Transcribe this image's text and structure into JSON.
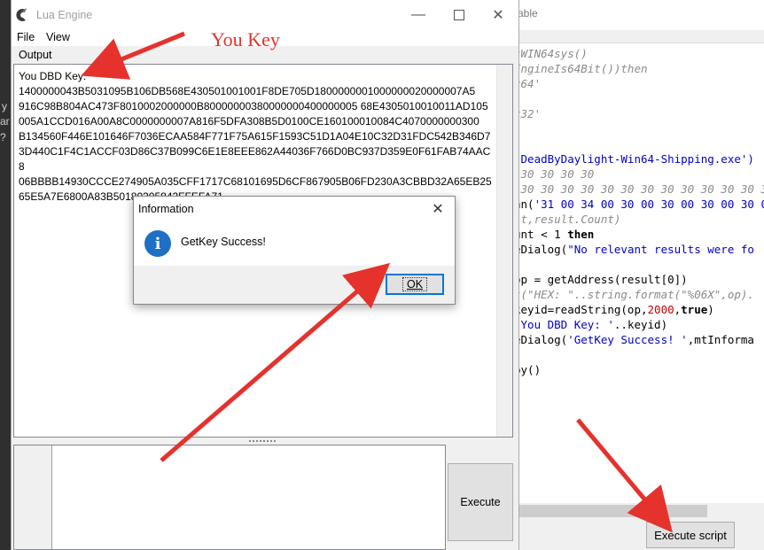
{
  "background_editor": {
    "title_fragment": "able",
    "code_lines": [
      {
        "parts": [
          {
            "t": "sWIN64sys()",
            "c": "c-gray"
          }
        ]
      },
      {
        "parts": [
          {
            "t": "EngineIs64Bit())then",
            "c": "c-gray"
          }
        ]
      },
      {
        "parts": [
          {
            "t": "x64'",
            "c": "c-gray"
          }
        ]
      },
      {
        "parts": []
      },
      {
        "parts": [
          {
            "t": "x32'",
            "c": "c-gray"
          }
        ]
      },
      {
        "parts": []
      },
      {
        "parts": []
      },
      {
        "parts": [
          {
            "t": "'DeadByDaylight-Win64-Shipping.exe')",
            "c": "c-blue"
          }
        ]
      },
      {
        "parts": [
          {
            "t": " 30 30 30 30",
            "c": "c-gray"
          }
        ]
      },
      {
        "parts": [
          {
            "t": " 30 30 30 30 30 30 30 30 30 30 30 30 30 30 (",
            "c": "c-gray"
          }
        ]
      },
      {
        "parts": [
          {
            "t": "an(",
            "c": "c-black"
          },
          {
            "t": "'31 00 34 00 30 00 30 00 30 00 30 00 30 00",
            "c": "c-blue"
          }
        ]
      },
      {
        "parts": [
          {
            "t": "lt,result.Count)",
            "c": "c-gray"
          }
        ]
      },
      {
        "parts": [
          {
            "t": "unt < ",
            "c": "c-black"
          },
          {
            "t": "1",
            "c": "c-black"
          },
          {
            "t": " then",
            "c": "c-black c-bold"
          }
        ]
      },
      {
        "parts": [
          {
            "t": "eDialog(",
            "c": "c-black"
          },
          {
            "t": "\"No relevant results were fo",
            "c": "c-blue"
          }
        ]
      },
      {
        "parts": []
      },
      {
        "parts": [
          {
            "t": "op = getAddress(result[",
            "c": "c-black"
          },
          {
            "t": "0",
            "c": "c-black"
          },
          {
            "t": "])",
            "c": "c-black"
          }
        ]
      },
      {
        "parts": [
          {
            "t": "t(\"HEX: \"..string.format(\"%06X\",op).",
            "c": "c-gray"
          }
        ]
      },
      {
        "parts": [
          {
            "t": "keyid=readString(op,",
            "c": "c-black"
          },
          {
            "t": "2000",
            "c": "c-red"
          },
          {
            "t": ",",
            "c": "c-black"
          },
          {
            "t": "true",
            "c": "c-black c-bold"
          },
          {
            "t": ")",
            "c": "c-black"
          }
        ]
      },
      {
        "parts": [
          {
            "t": "'You DBD Key: '",
            "c": "c-blue"
          },
          {
            "t": "..keyid)",
            "c": "c-black"
          }
        ]
      },
      {
        "parts": [
          {
            "t": "eDialog(",
            "c": "c-black"
          },
          {
            "t": "'GetKey Success! '",
            "c": "c-blue"
          },
          {
            "t": ",mtInforma",
            "c": "c-black"
          }
        ]
      },
      {
        "parts": []
      },
      {
        "parts": [
          {
            "t": "py()",
            "c": "c-black"
          }
        ]
      }
    ],
    "execute_script_label": "Execute script"
  },
  "left_sliver": {
    "fragments": [
      "y",
      "ar",
      "?"
    ]
  },
  "lua_window": {
    "title": "Lua Engine",
    "menu": {
      "file": "File",
      "view": "View"
    },
    "output_label": "Output",
    "output_text": "You DBD Key: 1400000043B5031095B106DB568E430501001001F8DE705D180000000100000002000000 7A5916C98B804AC473F8010002000000B80000000380000000400000005 68E4305010010011AD105005A1CCD016A00A8C0000000007A816F5DFA30 8B5D0100CE16010001 0084C4070000000300B134560F446E101646F703 6ECAA584F771F75A615F1593C51D1A04E10C32D31FDC542B346D73D440C 1F4C1ACCF03D86C37B099C6E1E8EEE862A44036F766D0BC937D359E0F61 FAB74AAC806BBBB14930CCCE274905A035CFF1717C68101695D6CF867905 B06FD230A3CBBD32A65EB2565E5A7E6800A83B50180305843FFEFA71",
    "output_heading": "You DBD Key:",
    "output_key_lines": [
      "1400000043B5031095B106DB568E430501001001F8DE705D1800000001000000020000007A5",
      "916C98B804AC473F8010002000000B80000000380000000400000005 68E4305010010011AD105",
      "005A1CCD016A00A8C0000000007A816F5DFA308B5D0100CE160100010084C4070000000300",
      "B134560F446E101646F7036ECAA584F771F75A615F1593C51D1A04E10C32D31FDC542B346D7",
      "3D440C1F4C1ACCF03D86C37B099C6E1E8EEE862A44036F766D0BC937D359E0F61FAB74AAC8",
      "06BBBB14930CCCE274905A035CFF1717C68101695D6CF867905B06FD230A3CBBD32A65EB25",
      "65E5A7E6800A83B50180305843FFEFA71"
    ],
    "execute_label": "Execute"
  },
  "info_dialog": {
    "title": "Information",
    "message": "GetKey Success!",
    "ok_label": "OK"
  },
  "annotations": {
    "label": "You Key",
    "color": "#e5322d"
  }
}
